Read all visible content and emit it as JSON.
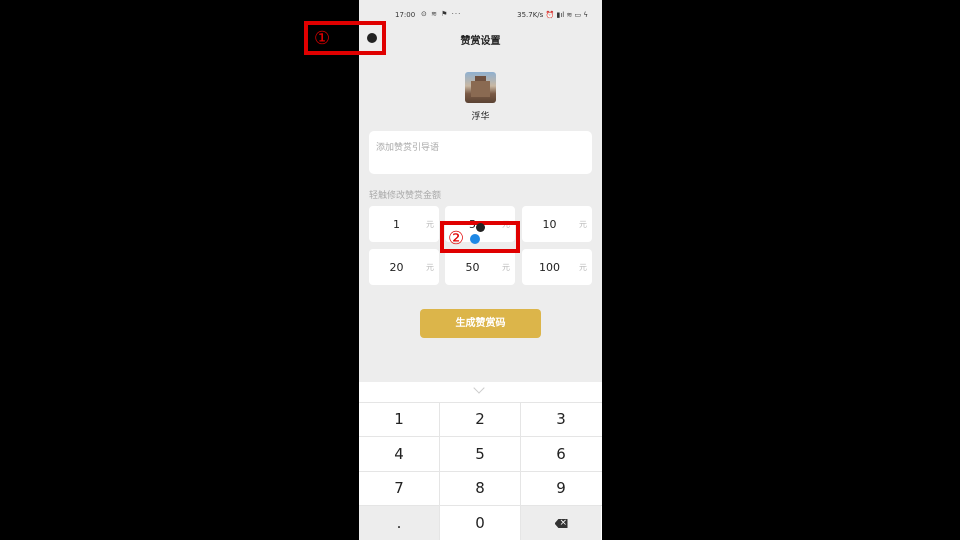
{
  "status_bar": {
    "time": "17:00",
    "icons": "⊙ ≋ ⚑ ···",
    "right": "35.7K/s ⏰ ▮ıl ≋ ▭ ϟ"
  },
  "header": {
    "title": "赞赏设置"
  },
  "profile": {
    "name": "浮华"
  },
  "message": {
    "placeholder": "添加赞赏引导语"
  },
  "amount_section": {
    "label": "轻触修改赞赏金额",
    "unit": "元",
    "amounts": [
      "1",
      "5",
      "10",
      "20",
      "50",
      "100"
    ]
  },
  "generate_button": {
    "label": "生成赞赏码"
  },
  "keypad": {
    "keys": [
      "1",
      "2",
      "3",
      "4",
      "5",
      "6",
      "7",
      "8",
      "9",
      ".",
      "0"
    ]
  },
  "annotations": [
    "①",
    "②"
  ],
  "colors": {
    "accent": "#dcb54a",
    "annotation": "#e00000",
    "tap": "#1e88e5"
  }
}
